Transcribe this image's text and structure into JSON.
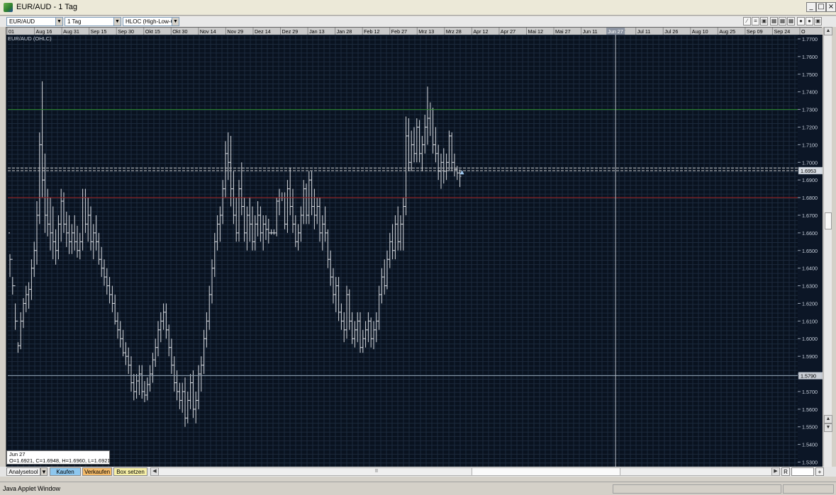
{
  "window": {
    "title": "EUR/AUD - 1 Tag"
  },
  "toolbar": {
    "symbol": "EUR/AUD",
    "interval": "1 Tag",
    "chart_type": "HLOC (High-Low-Op"
  },
  "chart_data": {
    "type": "ohlc",
    "series_label": "EUR/AUD (OHLC)",
    "x_ticks": [
      "01",
      "Aug 16",
      "Aug 31",
      "Sep 15",
      "Sep 30",
      "Okt 15",
      "Okt 30",
      "Nov 14",
      "Nov 29",
      "Dez 14",
      "Dez 29",
      "Jan 13",
      "Jan 28",
      "Feb 12",
      "Feb 27",
      "Mrz 13",
      "Mrz 28",
      "Apr 12",
      "Apr 27",
      "Mai 12",
      "Mai 27",
      "Jun 11",
      "Jun 27",
      "Jul 11",
      "Jul 26",
      "Aug 10",
      "Aug 25",
      "Sep 09",
      "Sep 24",
      "O"
    ],
    "y_ticks": [
      "1.7700",
      "1.7600",
      "1.7500",
      "1.7400",
      "1.7300",
      "1.7200",
      "1.7100",
      "1.7000",
      "1.6900",
      "1.6800",
      "1.6700",
      "1.6600",
      "1.6500",
      "1.6400",
      "1.6300",
      "1.6200",
      "1.6100",
      "1.6000",
      "1.5900",
      "1.5800",
      "1.5700",
      "1.5600",
      "1.5500",
      "1.5400",
      "1.5300"
    ],
    "ylim": [
      1.527,
      1.772
    ],
    "grid": true,
    "hlines": [
      {
        "value": 1.73,
        "color": "#2e8b2e"
      },
      {
        "value": 1.68,
        "color": "#a02020"
      },
      {
        "value": 1.6953,
        "color": "#c8c8c8",
        "label": "1.6953"
      },
      {
        "value": 1.6968,
        "color": "#c8c8c8"
      },
      {
        "value": 1.579,
        "color": "#8a9aaa",
        "label": "1.5790"
      }
    ],
    "cursor_label": "Jun 27",
    "close_marker": 1.694,
    "bars": [
      [
        1.66,
        1.648,
        1.635,
        1.645
      ],
      [
        1.645,
        1.635,
        1.625,
        1.63
      ],
      [
        1.63,
        1.62,
        1.605,
        1.61
      ],
      [
        1.61,
        1.598,
        1.592,
        1.596
      ],
      [
        1.596,
        1.615,
        1.594,
        1.61
      ],
      [
        1.61,
        1.623,
        1.606,
        1.62
      ],
      [
        1.62,
        1.63,
        1.615,
        1.625
      ],
      [
        1.625,
        1.632,
        1.617,
        1.628
      ],
      [
        1.628,
        1.645,
        1.622,
        1.64
      ],
      [
        1.64,
        1.655,
        1.635,
        1.65
      ],
      [
        1.65,
        1.678,
        1.642,
        1.67
      ],
      [
        1.67,
        1.717,
        1.665,
        1.71
      ],
      [
        1.71,
        1.746,
        1.68,
        1.69
      ],
      [
        1.69,
        1.705,
        1.66,
        1.67
      ],
      [
        1.67,
        1.685,
        1.658,
        1.665
      ],
      [
        1.665,
        1.68,
        1.65,
        1.66
      ],
      [
        1.66,
        1.675,
        1.645,
        1.655
      ],
      [
        1.655,
        1.662,
        1.642,
        1.65
      ],
      [
        1.65,
        1.67,
        1.645,
        1.665
      ],
      [
        1.665,
        1.685,
        1.655,
        1.678
      ],
      [
        1.678,
        1.683,
        1.66,
        1.665
      ],
      [
        1.665,
        1.672,
        1.652,
        1.66
      ],
      [
        1.66,
        1.67,
        1.648,
        1.655
      ],
      [
        1.655,
        1.665,
        1.648,
        1.66
      ],
      [
        1.66,
        1.67,
        1.65,
        1.655
      ],
      [
        1.655,
        1.664,
        1.646,
        1.65
      ],
      [
        1.65,
        1.66,
        1.645,
        1.655
      ],
      [
        1.655,
        1.685,
        1.65,
        1.68
      ],
      [
        1.68,
        1.685,
        1.66,
        1.665
      ],
      [
        1.665,
        1.68,
        1.655,
        1.67
      ],
      [
        1.67,
        1.675,
        1.65,
        1.655
      ],
      [
        1.655,
        1.665,
        1.645,
        1.66
      ],
      [
        1.66,
        1.67,
        1.65,
        1.655
      ],
      [
        1.655,
        1.66,
        1.642,
        1.645
      ],
      [
        1.645,
        1.652,
        1.635,
        1.64
      ],
      [
        1.64,
        1.645,
        1.63,
        1.635
      ],
      [
        1.635,
        1.64,
        1.625,
        1.63
      ],
      [
        1.63,
        1.635,
        1.62,
        1.625
      ],
      [
        1.625,
        1.63,
        1.615,
        1.62
      ],
      [
        1.62,
        1.625,
        1.608,
        1.61
      ],
      [
        1.61,
        1.615,
        1.6,
        1.605
      ],
      [
        1.605,
        1.61,
        1.595,
        1.6
      ],
      [
        1.6,
        1.605,
        1.59,
        1.592
      ],
      [
        1.592,
        1.598,
        1.585,
        1.59
      ],
      [
        1.59,
        1.595,
        1.58,
        1.585
      ],
      [
        1.585,
        1.59,
        1.57,
        1.575
      ],
      [
        1.575,
        1.58,
        1.565,
        1.57
      ],
      [
        1.57,
        1.58,
        1.566,
        1.576
      ],
      [
        1.576,
        1.585,
        1.568,
        1.58
      ],
      [
        1.58,
        1.585,
        1.566,
        1.57
      ],
      [
        1.57,
        1.576,
        1.564,
        1.568
      ],
      [
        1.568,
        1.578,
        1.565,
        1.574
      ],
      [
        1.574,
        1.585,
        1.57,
        1.58
      ],
      [
        1.58,
        1.592,
        1.575,
        1.588
      ],
      [
        1.588,
        1.6,
        1.584,
        1.595
      ],
      [
        1.595,
        1.61,
        1.59,
        1.605
      ],
      [
        1.605,
        1.615,
        1.598,
        1.61
      ],
      [
        1.61,
        1.62,
        1.605,
        1.615
      ],
      [
        1.615,
        1.62,
        1.6,
        1.605
      ],
      [
        1.605,
        1.608,
        1.59,
        1.595
      ],
      [
        1.595,
        1.6,
        1.58,
        1.585
      ],
      [
        1.585,
        1.59,
        1.57,
        1.575
      ],
      [
        1.575,
        1.582,
        1.565,
        1.57
      ],
      [
        1.57,
        1.575,
        1.56,
        1.565
      ],
      [
        1.565,
        1.575,
        1.558,
        1.57
      ],
      [
        1.57,
        1.578,
        1.55,
        1.555
      ],
      [
        1.555,
        1.57,
        1.552,
        1.565
      ],
      [
        1.565,
        1.58,
        1.56,
        1.575
      ],
      [
        1.575,
        1.582,
        1.555,
        1.56
      ],
      [
        1.56,
        1.57,
        1.552,
        1.565
      ],
      [
        1.565,
        1.585,
        1.56,
        1.58
      ],
      [
        1.58,
        1.59,
        1.57,
        1.585
      ],
      [
        1.585,
        1.605,
        1.58,
        1.6
      ],
      [
        1.6,
        1.615,
        1.595,
        1.61
      ],
      [
        1.61,
        1.63,
        1.605,
        1.625
      ],
      [
        1.625,
        1.645,
        1.62,
        1.64
      ],
      [
        1.64,
        1.66,
        1.635,
        1.655
      ],
      [
        1.655,
        1.67,
        1.65,
        1.665
      ],
      [
        1.665,
        1.675,
        1.655,
        1.67
      ],
      [
        1.67,
        1.69,
        1.665,
        1.685
      ],
      [
        1.685,
        1.712,
        1.68,
        1.705
      ],
      [
        1.705,
        1.717,
        1.69,
        1.7
      ],
      [
        1.7,
        1.715,
        1.675,
        1.685
      ],
      [
        1.685,
        1.695,
        1.665,
        1.67
      ],
      [
        1.67,
        1.68,
        1.655,
        1.66
      ],
      [
        1.66,
        1.69,
        1.655,
        1.685
      ],
      [
        1.685,
        1.7,
        1.67,
        1.675
      ],
      [
        1.675,
        1.68,
        1.655,
        1.66
      ],
      [
        1.66,
        1.675,
        1.65,
        1.67
      ],
      [
        1.67,
        1.68,
        1.655,
        1.665
      ],
      [
        1.665,
        1.675,
        1.65,
        1.655
      ],
      [
        1.655,
        1.67,
        1.65,
        1.665
      ],
      [
        1.665,
        1.678,
        1.658,
        1.67
      ],
      [
        1.67,
        1.675,
        1.655,
        1.66
      ],
      [
        1.66,
        1.67,
        1.65,
        1.665
      ],
      [
        1.665,
        1.67,
        1.656,
        1.662
      ],
      [
        1.662,
        1.668,
        1.654,
        1.66
      ],
      [
        1.66,
        1.662,
        1.659,
        1.66
      ],
      [
        1.66,
        1.662,
        1.659,
        1.66
      ],
      [
        1.66,
        1.68,
        1.658,
        1.678
      ],
      [
        1.678,
        1.685,
        1.67,
        1.68
      ],
      [
        1.68,
        1.683,
        1.678,
        1.68
      ],
      [
        1.68,
        1.683,
        1.662,
        1.665
      ],
      [
        1.665,
        1.69,
        1.66,
        1.685
      ],
      [
        1.685,
        1.697,
        1.67,
        1.675
      ],
      [
        1.675,
        1.685,
        1.66,
        1.665
      ],
      [
        1.665,
        1.67,
        1.652,
        1.655
      ],
      [
        1.655,
        1.665,
        1.65,
        1.66
      ],
      [
        1.66,
        1.675,
        1.655,
        1.67
      ],
      [
        1.67,
        1.69,
        1.665,
        1.685
      ],
      [
        1.685,
        1.688,
        1.665,
        1.67
      ],
      [
        1.67,
        1.695,
        1.665,
        1.69
      ],
      [
        1.69,
        1.695,
        1.67,
        1.675
      ],
      [
        1.675,
        1.685,
        1.662,
        1.67
      ],
      [
        1.67,
        1.68,
        1.665,
        1.675
      ],
      [
        1.675,
        1.68,
        1.655,
        1.66
      ],
      [
        1.66,
        1.67,
        1.65,
        1.665
      ],
      [
        1.665,
        1.675,
        1.655,
        1.66
      ],
      [
        1.66,
        1.662,
        1.64,
        1.645
      ],
      [
        1.645,
        1.65,
        1.63,
        1.635
      ],
      [
        1.635,
        1.64,
        1.62,
        1.625
      ],
      [
        1.625,
        1.635,
        1.615,
        1.63
      ],
      [
        1.63,
        1.635,
        1.61,
        1.615
      ],
      [
        1.615,
        1.62,
        1.605,
        1.61
      ],
      [
        1.61,
        1.615,
        1.598,
        1.605
      ],
      [
        1.605,
        1.63,
        1.6,
        1.625
      ],
      [
        1.625,
        1.628,
        1.605,
        1.61
      ],
      [
        1.61,
        1.615,
        1.597,
        1.6
      ],
      [
        1.6,
        1.61,
        1.595,
        1.605
      ],
      [
        1.605,
        1.615,
        1.598,
        1.61
      ],
      [
        1.61,
        1.615,
        1.592,
        1.595
      ],
      [
        1.595,
        1.605,
        1.592,
        1.6
      ],
      [
        1.6,
        1.61,
        1.595,
        1.605
      ],
      [
        1.605,
        1.615,
        1.598,
        1.61
      ],
      [
        1.61,
        1.612,
        1.595,
        1.6
      ],
      [
        1.6,
        1.61,
        1.594,
        1.605
      ],
      [
        1.605,
        1.615,
        1.598,
        1.61
      ],
      [
        1.61,
        1.63,
        1.605,
        1.625
      ],
      [
        1.625,
        1.64,
        1.62,
        1.635
      ],
      [
        1.635,
        1.645,
        1.625,
        1.63
      ],
      [
        1.63,
        1.65,
        1.628,
        1.645
      ],
      [
        1.645,
        1.66,
        1.64,
        1.655
      ],
      [
        1.655,
        1.665,
        1.645,
        1.65
      ],
      [
        1.65,
        1.67,
        1.645,
        1.665
      ],
      [
        1.665,
        1.675,
        1.65,
        1.655
      ],
      [
        1.655,
        1.67,
        1.65,
        1.665
      ],
      [
        1.665,
        1.68,
        1.65,
        1.675
      ],
      [
        1.675,
        1.726,
        1.67,
        1.715
      ],
      [
        1.715,
        1.725,
        1.695,
        1.7
      ],
      [
        1.7,
        1.718,
        1.695,
        1.71
      ],
      [
        1.71,
        1.72,
        1.7,
        1.705
      ],
      [
        1.705,
        1.725,
        1.7,
        1.72
      ],
      [
        1.72,
        1.724,
        1.7,
        1.705
      ],
      [
        1.705,
        1.715,
        1.695,
        1.71
      ],
      [
        1.71,
        1.727,
        1.705,
        1.72
      ],
      [
        1.72,
        1.743,
        1.71,
        1.725
      ],
      [
        1.725,
        1.734,
        1.715,
        1.73
      ],
      [
        1.73,
        1.731,
        1.705,
        1.71
      ],
      [
        1.71,
        1.72,
        1.7,
        1.705
      ],
      [
        1.705,
        1.71,
        1.69,
        1.695
      ],
      [
        1.695,
        1.705,
        1.685,
        1.7
      ],
      [
        1.7,
        1.708,
        1.688,
        1.695
      ],
      [
        1.695,
        1.705,
        1.69,
        1.7
      ],
      [
        1.7,
        1.718,
        1.695,
        1.715
      ],
      [
        1.715,
        1.717,
        1.695,
        1.7
      ],
      [
        1.7,
        1.705,
        1.692,
        1.696
      ],
      [
        1.696,
        1.698,
        1.69,
        1.694
      ],
      [
        1.694,
        1.696,
        1.686,
        1.6921
      ]
    ]
  },
  "info_box": {
    "date": "Jun 27",
    "values": "O=1.6921, C=1.6948, H=1.6960, L=1.6921"
  },
  "bottombar": {
    "analysis_tool": "Analysetool",
    "buy": "Kaufen",
    "sell": "Verkaufen",
    "set_box": "Box setzen",
    "scroll_grip": "II",
    "scroll_right_btn": "R",
    "plus_btn": "+"
  },
  "statusbar": {
    "text": "Java Applet Window"
  },
  "colors": {
    "chart_bg": "#09121f",
    "grid": "#1c2a3d",
    "bar": "#d8dbe0",
    "buy_button": "#8ec7ee",
    "sell_button": "#f5bb6a",
    "set_box_button": "#f7f0a8"
  }
}
